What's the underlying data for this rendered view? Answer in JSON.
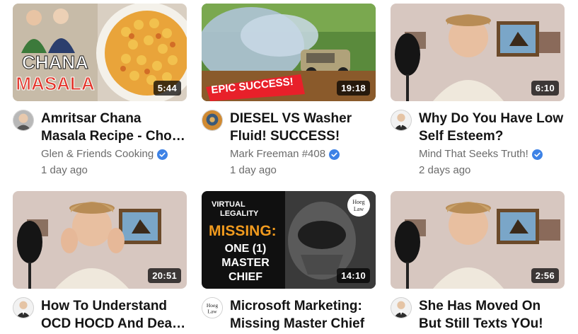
{
  "videos": [
    {
      "title": "Amritsar Chana Masala Recipe - Chole Masala",
      "channel": "Glen & Friends Cooking",
      "verified": true,
      "age": "1 day ago",
      "duration": "5:44",
      "thumb_text": [
        "CHANA",
        "MASALA"
      ],
      "avatar_icon": "person-avatar-icon"
    },
    {
      "title": "DIESEL VS Washer Fluid! SUCCESS!",
      "channel": "Mark Freeman #408",
      "verified": true,
      "age": "1 day ago",
      "duration": "19:18",
      "thumb_text": [
        "EPIC SUCCESS!"
      ],
      "avatar_icon": "person-avatar-icon"
    },
    {
      "title": "Why Do You Have Low Self Esteem?",
      "channel": "Mind That Seeks Truth!",
      "verified": true,
      "age": "2 days ago",
      "duration": "6:10",
      "thumb_text": [],
      "avatar_icon": "person-avatar-icon"
    },
    {
      "title": "How To Understand OCD HOCD And Deal With It",
      "duration": "20:51",
      "thumb_text": [],
      "avatar_icon": "person-avatar-icon"
    },
    {
      "title": "Microsoft Marketing: Missing Master Chief",
      "duration": "14:10",
      "thumb_text": [
        "VIRTUAL",
        "LEGALITY",
        "MISSING:",
        "ONE (1)",
        "MASTER",
        "CHIEF",
        "Hoeg",
        "Law"
      ],
      "avatar_text": [
        "Hoeg",
        "Law"
      ]
    },
    {
      "title": "She Has Moved On But Still Texts YOu!",
      "duration": "2:56",
      "thumb_text": [],
      "avatar_icon": "person-avatar-icon"
    }
  ],
  "colors": {
    "verified": "#3d82e6",
    "title": "#141414",
    "meta": "#6b6b6b"
  }
}
